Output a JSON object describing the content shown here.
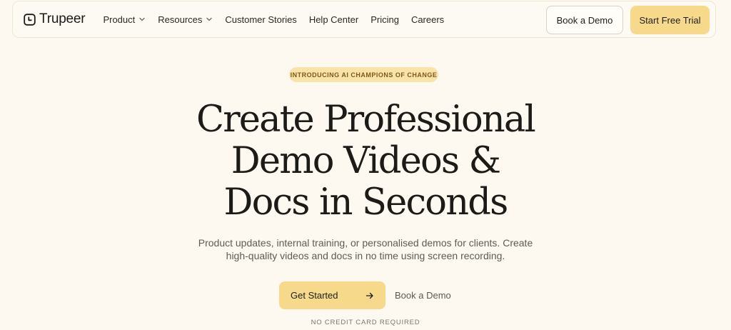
{
  "nav": {
    "brand": "Trupeer",
    "logo_icon": "trupeer-logo-icon",
    "items": [
      {
        "label": "Product",
        "has_dropdown": true
      },
      {
        "label": "Resources",
        "has_dropdown": true
      },
      {
        "label": "Customer Stories",
        "has_dropdown": false
      },
      {
        "label": "Help Center",
        "has_dropdown": false
      },
      {
        "label": "Pricing",
        "has_dropdown": false
      },
      {
        "label": "Careers",
        "has_dropdown": false
      }
    ],
    "book_demo": "Book a Demo",
    "start_trial": "Start Free Trial"
  },
  "hero": {
    "badge": "INTRODUCING AI CHAMPIONS OF CHANGE",
    "headline_line1": "Create Professional",
    "headline_line2": "Demo Videos &",
    "headline_line3": "Docs in Seconds",
    "subtitle_line1": "Product updates, internal training, or personalised demos for clients. Create",
    "subtitle_line2": "high-quality videos and docs in no time using screen recording.",
    "get_started": "Get Started",
    "book_demo": "Book a Demo",
    "no_credit_card": "NO CREDIT CARD REQUIRED"
  },
  "colors": {
    "background": "#fdf9f1",
    "accent": "#f6d98b",
    "badge_bg": "#f9e3a8",
    "badge_text": "#7a5a1c",
    "text": "#1f1d1a"
  }
}
